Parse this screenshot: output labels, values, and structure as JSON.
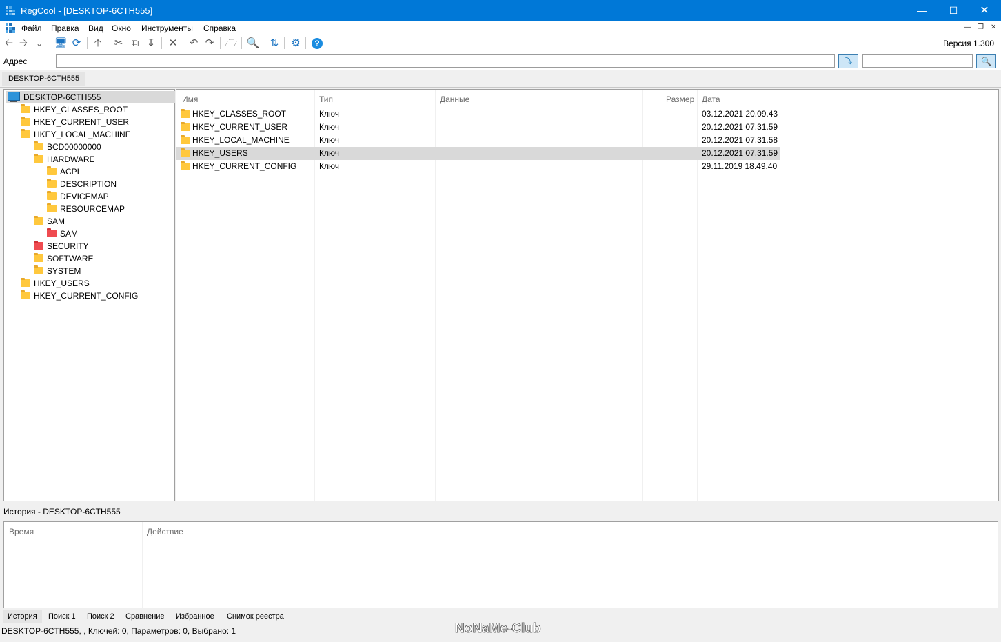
{
  "window": {
    "title": "RegCool - [DESKTOP-6CTH555]",
    "accent": "#0078d7"
  },
  "menu": [
    "Файл",
    "Правка",
    "Вид",
    "Окно",
    "Инструменты",
    "Справка"
  ],
  "toolbar": {
    "icons": [
      "back-arrow-icon",
      "forward-arrow-icon",
      "dropdown-chevron-icon",
      "computer-icon",
      "remote-registry-icon",
      "up-level-icon",
      "cut-icon",
      "copy-icon",
      "export-icon",
      "delete-icon",
      "undo-icon",
      "redo-icon",
      "new-key-icon",
      "find-icon",
      "refresh-icon",
      "settings-icon",
      "help-icon"
    ],
    "version": "Версия 1.300"
  },
  "address": {
    "label": "Адрес",
    "value": "",
    "search_value": ""
  },
  "doc_tab": "DESKTOP-6CTH555",
  "tree": [
    {
      "label": "DESKTOP-6CTH555",
      "level": 0,
      "icon": "computer",
      "selected": true
    },
    {
      "label": "HKEY_CLASSES_ROOT",
      "level": 1,
      "icon": "folder"
    },
    {
      "label": "HKEY_CURRENT_USER",
      "level": 1,
      "icon": "folder"
    },
    {
      "label": "HKEY_LOCAL_MACHINE",
      "level": 1,
      "icon": "folder"
    },
    {
      "label": "BCD00000000",
      "level": 2,
      "icon": "folder"
    },
    {
      "label": "HARDWARE",
      "level": 2,
      "icon": "folder"
    },
    {
      "label": "ACPI",
      "level": 3,
      "icon": "folder"
    },
    {
      "label": "DESCRIPTION",
      "level": 3,
      "icon": "folder"
    },
    {
      "label": "DEVICEMAP",
      "level": 3,
      "icon": "folder"
    },
    {
      "label": "RESOURCEMAP",
      "level": 3,
      "icon": "folder"
    },
    {
      "label": "SAM",
      "level": 2,
      "icon": "folder"
    },
    {
      "label": "SAM",
      "level": 3,
      "icon": "folder-red"
    },
    {
      "label": "SECURITY",
      "level": 2,
      "icon": "folder-red"
    },
    {
      "label": "SOFTWARE",
      "level": 2,
      "icon": "folder"
    },
    {
      "label": "SYSTEM",
      "level": 2,
      "icon": "folder"
    },
    {
      "label": "HKEY_USERS",
      "level": 1,
      "icon": "folder"
    },
    {
      "label": "HKEY_CURRENT_CONFIG",
      "level": 1,
      "icon": "folder"
    }
  ],
  "list": {
    "columns": [
      "Имя",
      "Тип",
      "Данные",
      "Размер",
      "Дата"
    ],
    "rows": [
      {
        "name": "HKEY_CLASSES_ROOT",
        "type": "Ключ",
        "data": "",
        "size": "",
        "date": "03.12.2021 20.09.43"
      },
      {
        "name": "HKEY_CURRENT_USER",
        "type": "Ключ",
        "data": "",
        "size": "",
        "date": "20.12.2021 07.31.59"
      },
      {
        "name": "HKEY_LOCAL_MACHINE",
        "type": "Ключ",
        "data": "",
        "size": "",
        "date": "20.12.2021 07.31.58"
      },
      {
        "name": "HKEY_USERS",
        "type": "Ключ",
        "data": "",
        "size": "",
        "date": "20.12.2021 07.31.59",
        "selected": true
      },
      {
        "name": "HKEY_CURRENT_CONFIG",
        "type": "Ключ",
        "data": "",
        "size": "",
        "date": "29.11.2019 18.49.40"
      }
    ]
  },
  "history": {
    "title": "История - DESKTOP-6CTH555",
    "columns": [
      "Время",
      "Действие"
    ]
  },
  "bottom_tabs": [
    "История",
    "Поиск 1",
    "Поиск 2",
    "Сравнение",
    "Избранное",
    "Снимок реестра"
  ],
  "status": "DESKTOP-6CTH555, , Ключей: 0, Параметров: 0, Выбрано: 1",
  "watermark": "NoNaMe-Club"
}
